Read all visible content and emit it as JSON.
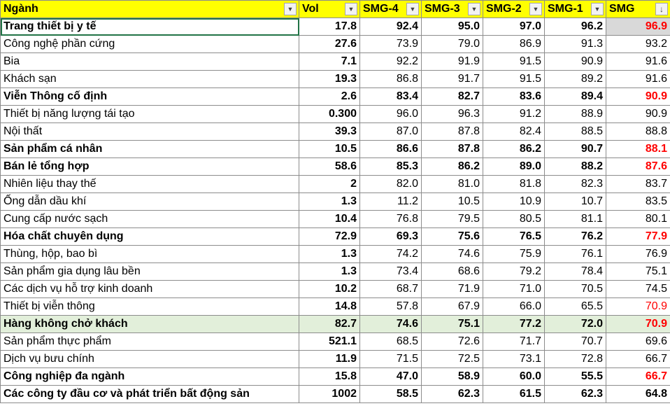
{
  "columns": [
    {
      "label": "Ngành",
      "button": "filter"
    },
    {
      "label": "Vol",
      "button": "filter"
    },
    {
      "label": "SMG-4",
      "button": "filter"
    },
    {
      "label": "SMG-3",
      "button": "filter"
    },
    {
      "label": "SMG-2",
      "button": "filter"
    },
    {
      "label": "SMG-1",
      "button": "filter"
    },
    {
      "label": "SMG",
      "button": "sort-desc"
    }
  ],
  "rows": [
    {
      "name": "Trang thiết bị y tế",
      "vol": "17.8",
      "smg4": "92.4",
      "smg3": "95.0",
      "smg2": "97.0",
      "smg1": "96.2",
      "smg": "96.9",
      "bold": true,
      "smg_red": true,
      "selected": true,
      "smg_gray": true
    },
    {
      "name": "Công nghệ phần cứng",
      "vol": "27.6",
      "smg4": "73.9",
      "smg3": "79.0",
      "smg2": "86.9",
      "smg1": "91.3",
      "smg": "93.2"
    },
    {
      "name": "Bia",
      "vol": "7.1",
      "smg4": "92.2",
      "smg3": "91.9",
      "smg2": "91.5",
      "smg1": "90.9",
      "smg": "91.6"
    },
    {
      "name": "Khách sạn",
      "vol": "19.3",
      "smg4": "86.8",
      "smg3": "91.7",
      "smg2": "91.5",
      "smg1": "89.2",
      "smg": "91.6"
    },
    {
      "name": "Viễn Thông cố định",
      "vol": "2.6",
      "smg4": "83.4",
      "smg3": "82.7",
      "smg2": "83.6",
      "smg1": "89.4",
      "smg": "90.9",
      "bold": true,
      "smg_red": true
    },
    {
      "name": "Thiết bị năng lượng tái tạo",
      "vol": "0.300",
      "smg4": "96.0",
      "smg3": "96.3",
      "smg2": "91.2",
      "smg1": "88.9",
      "smg": "90.9"
    },
    {
      "name": "Nội thất",
      "vol": "39.3",
      "smg4": "87.0",
      "smg3": "87.8",
      "smg2": "82.4",
      "smg1": "88.5",
      "smg": "88.8"
    },
    {
      "name": "Sản phẩm cá nhân",
      "vol": "10.5",
      "smg4": "86.6",
      "smg3": "87.8",
      "smg2": "86.2",
      "smg1": "90.7",
      "smg": "88.1",
      "bold": true,
      "smg_red": true
    },
    {
      "name": "Bán lẻ tổng hợp",
      "vol": "58.6",
      "smg4": "85.3",
      "smg3": "86.2",
      "smg2": "89.0",
      "smg1": "88.2",
      "smg": "87.6",
      "bold": true,
      "smg_red": true
    },
    {
      "name": "Nhiên liệu thay thế",
      "vol": "2",
      "smg4": "82.0",
      "smg3": "81.0",
      "smg2": "81.8",
      "smg1": "82.3",
      "smg": "83.7"
    },
    {
      "name": "Ống dẫn dầu khí",
      "vol": "1.3",
      "smg4": "11.2",
      "smg3": "10.5",
      "smg2": "10.9",
      "smg1": "10.7",
      "smg": "83.5"
    },
    {
      "name": "Cung cấp nước sạch",
      "vol": "10.4",
      "smg4": "76.8",
      "smg3": "79.5",
      "smg2": "80.5",
      "smg1": "81.1",
      "smg": "80.1"
    },
    {
      "name": "Hóa chất chuyên dụng",
      "vol": "72.9",
      "smg4": "69.3",
      "smg3": "75.6",
      "smg2": "76.5",
      "smg1": "76.2",
      "smg": "77.9",
      "bold": true,
      "smg_red": true
    },
    {
      "name": "Thùng, hộp, bao bì",
      "vol": "1.3",
      "smg4": "74.2",
      "smg3": "74.6",
      "smg2": "75.9",
      "smg1": "76.1",
      "smg": "76.9"
    },
    {
      "name": "Sản phẩm gia dụng lâu bền",
      "vol": "1.3",
      "smg4": "73.4",
      "smg3": "68.6",
      "smg2": "79.2",
      "smg1": "78.4",
      "smg": "75.1"
    },
    {
      "name": "Các dịch vụ hỗ trợ kinh doanh",
      "vol": "10.2",
      "smg4": "68.7",
      "smg3": "71.9",
      "smg2": "71.0",
      "smg1": "70.5",
      "smg": "74.5"
    },
    {
      "name": "Thiết bị viễn thông",
      "vol": "14.8",
      "smg4": "57.8",
      "smg3": "67.9",
      "smg2": "66.0",
      "smg1": "65.5",
      "smg": "70.9",
      "smg_red": true
    },
    {
      "name": "Hàng không chở khách",
      "vol": "82.7",
      "smg4": "74.6",
      "smg3": "75.1",
      "smg2": "77.2",
      "smg1": "72.0",
      "smg": "70.9",
      "bold": true,
      "smg_red": true,
      "green": true
    },
    {
      "name": "Sản phẩm thực phẩm",
      "vol": "521.1",
      "smg4": "68.5",
      "smg3": "72.6",
      "smg2": "71.7",
      "smg1": "70.7",
      "smg": "69.6"
    },
    {
      "name": "Dịch vụ bưu chính",
      "vol": "11.9",
      "smg4": "71.5",
      "smg3": "72.5",
      "smg2": "73.1",
      "smg1": "72.8",
      "smg": "66.7"
    },
    {
      "name": "Công nghiệp đa ngành",
      "vol": "15.8",
      "smg4": "47.0",
      "smg3": "58.9",
      "smg2": "60.0",
      "smg1": "55.5",
      "smg": "66.7",
      "bold": true,
      "smg_red": true
    },
    {
      "name": "Các công ty đầu cơ và phát triển bất động sản",
      "vol": "1002",
      "smg4": "58.5",
      "smg3": "62.3",
      "smg2": "61.5",
      "smg1": "62.3",
      "smg": "64.8",
      "bold": true
    }
  ],
  "colors": {
    "header_bg": "#ffff00",
    "highlight_red": "#ff0000",
    "selected_row_green": "#e2efda",
    "cell_gray": "#d9d9d9",
    "selection_border": "#217346"
  },
  "icons": {
    "filter": "dropdown-arrow-icon",
    "sort-desc": "sort-descending-icon"
  }
}
